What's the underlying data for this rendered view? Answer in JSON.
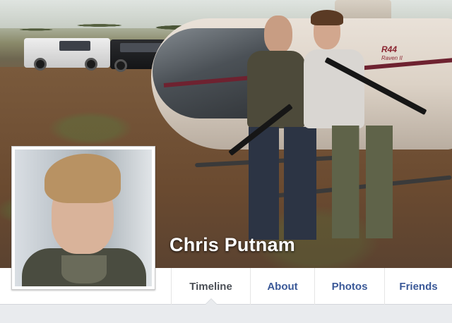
{
  "profile": {
    "name": "Chris Putnam"
  },
  "cover": {
    "aircraft_marking": "R44",
    "aircraft_marking_sub": "Raven II"
  },
  "tabs": [
    {
      "label": "Timeline",
      "active": true
    },
    {
      "label": "About",
      "active": false
    },
    {
      "label": "Photos",
      "active": false
    },
    {
      "label": "Friends",
      "active": false
    }
  ],
  "colors": {
    "link_blue": "#3b5998",
    "active_tab_text": "#4b4f56",
    "page_background": "#e9ebee"
  }
}
